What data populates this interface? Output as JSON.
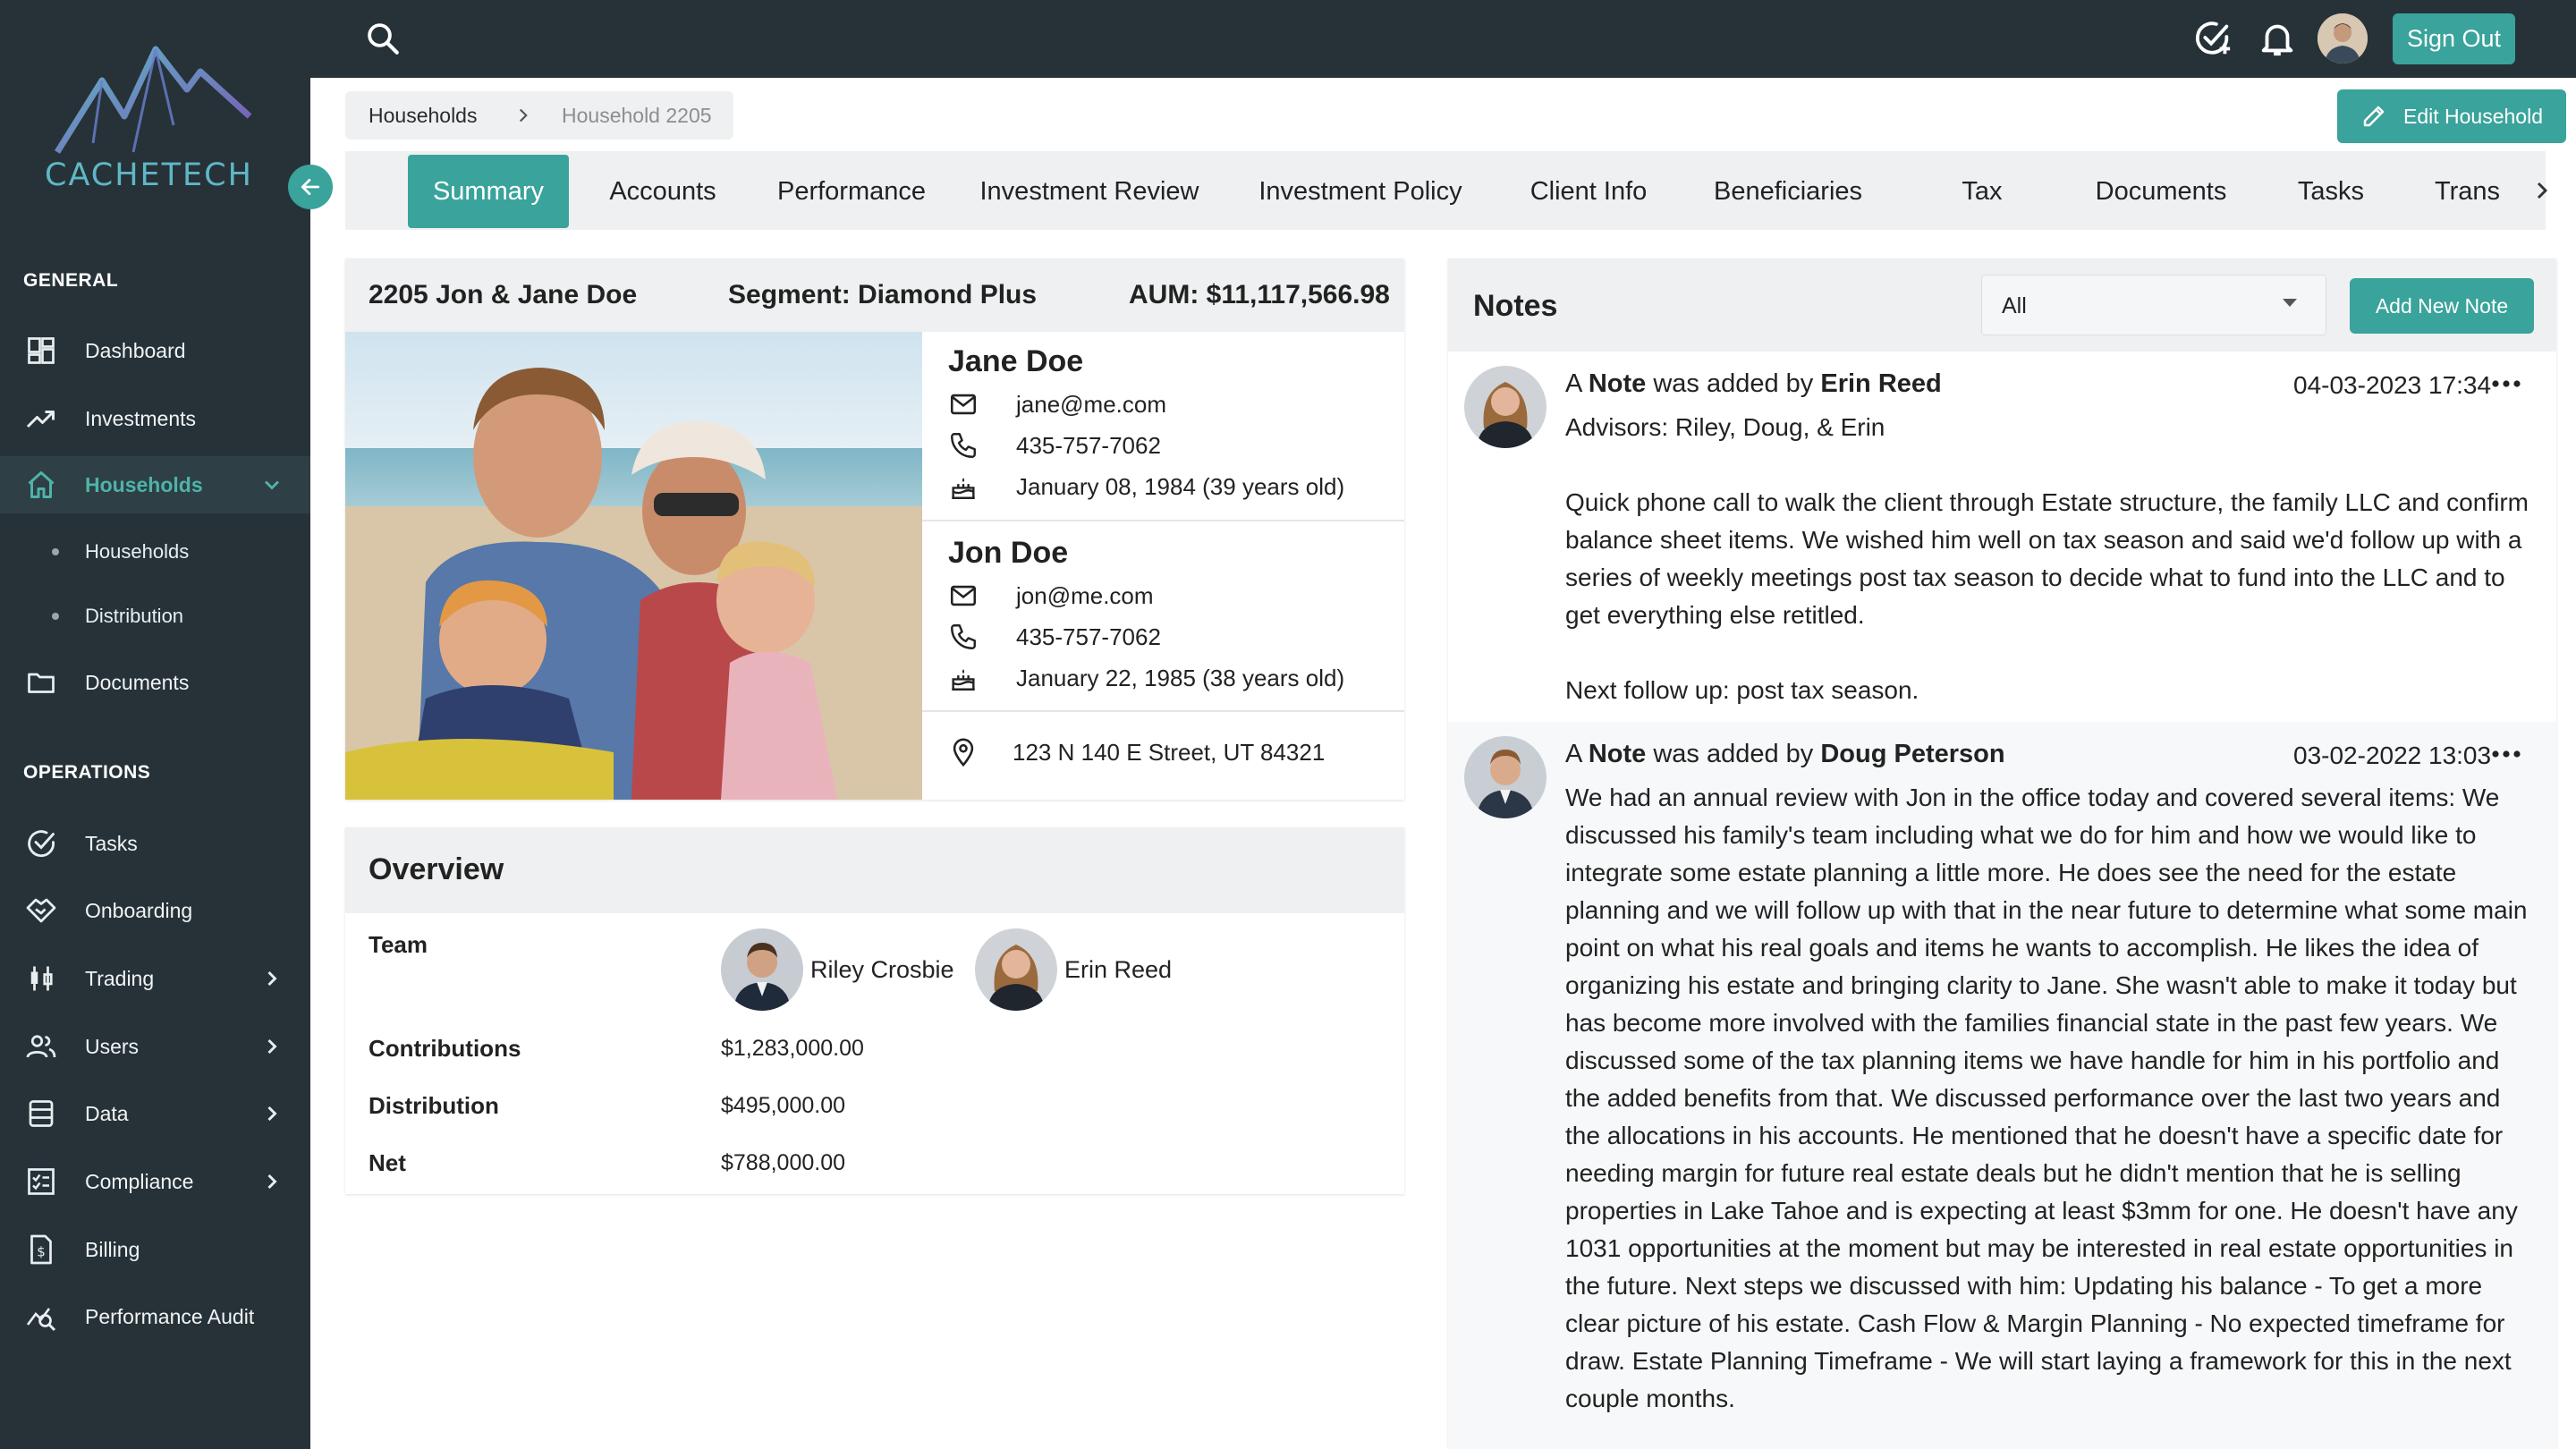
{
  "brand": {
    "name": "CACHETECH",
    "accent": "#3aa39b",
    "sidebar_bg": "#263238"
  },
  "sidebar": {
    "general_title": "GENERAL",
    "operations_title": "OPERATIONS",
    "items": [
      {
        "label": "Dashboard",
        "icon": "dashboard-icon"
      },
      {
        "label": "Investments",
        "icon": "trending-up-icon"
      },
      {
        "label": "Households",
        "icon": "home-icon",
        "active": true
      },
      {
        "label": "Documents",
        "icon": "folder-icon"
      },
      {
        "label": "Tasks",
        "icon": "check-circle-icon"
      },
      {
        "label": "Onboarding",
        "icon": "handshake-icon"
      },
      {
        "label": "Trading",
        "icon": "candlestick-icon"
      },
      {
        "label": "Users",
        "icon": "users-icon"
      },
      {
        "label": "Data",
        "icon": "database-icon"
      },
      {
        "label": "Compliance",
        "icon": "checklist-icon"
      },
      {
        "label": "Billing",
        "icon": "invoice-icon"
      },
      {
        "label": "Performance Audit",
        "icon": "audit-chart-icon"
      }
    ],
    "sub_items": [
      {
        "label": "Households"
      },
      {
        "label": "Distribution"
      }
    ]
  },
  "topbar": {
    "sign_out": "Sign Out"
  },
  "breadcrumb": {
    "root": "Households",
    "current": "Household 2205"
  },
  "edit_household": "Edit Household",
  "tabs": [
    {
      "label": "Summary",
      "active": true
    },
    {
      "label": "Accounts"
    },
    {
      "label": "Performance"
    },
    {
      "label": "Investment Review"
    },
    {
      "label": "Investment Policy"
    },
    {
      "label": "Client Info"
    },
    {
      "label": "Beneficiaries"
    },
    {
      "label": "Tax"
    },
    {
      "label": "Documents"
    },
    {
      "label": "Tasks"
    },
    {
      "label": "Trans"
    }
  ],
  "household": {
    "name": "2205 Jon & Jane Doe",
    "segment": "Segment: Diamond Plus",
    "aum": "AUM: $11,117,566.98",
    "people": [
      {
        "name": "Jane Doe",
        "email": "jane@me.com",
        "phone": "435-757-7062",
        "birthday": "January 08, 1984 (39 years old)"
      },
      {
        "name": "Jon Doe",
        "email": "jon@me.com",
        "phone": "435-757-7062",
        "birthday": "January 22, 1985 (38 years old)"
      }
    ],
    "address": "123 N 140 E Street, UT 84321"
  },
  "overview": {
    "title": "Overview",
    "team_label": "Team",
    "team": [
      {
        "name": "Riley Crosbie"
      },
      {
        "name": "Erin Reed"
      }
    ],
    "contributions_label": "Contributions",
    "contributions": "$1,283,000.00",
    "distribution_label": "Distribution",
    "distribution": "$495,000.00",
    "net_label": "Net",
    "net": "$788,000.00"
  },
  "notes": {
    "title": "Notes",
    "filter_value": "All",
    "add_button": "Add New Note",
    "items": [
      {
        "prefix": "A",
        "kind": "Note",
        "middle": "was added by",
        "author": "Erin Reed",
        "date": "04-03-2023 17:34",
        "paragraphs": [
          "Advisors: Riley, Doug, & Erin",
          "Quick phone call to walk the client through Estate structure, the family LLC and confirm balance sheet items. We wished him well on tax season and said we'd follow up with a series of weekly meetings post tax season to decide what to fund into the LLC and to get everything else retitled.",
          "Next follow up: post tax season."
        ]
      },
      {
        "prefix": "A",
        "kind": "Note",
        "middle": "was added by",
        "author": "Doug Peterson",
        "date": "03-02-2022 13:03",
        "paragraphs": [
          "We had an annual review with Jon in the office today and covered several items: We discussed his family's team including what we do for him and how we would like to integrate some estate planning a little more. He does see the need for the estate planning and we will follow up with that in the near future to determine what some main point on what his real goals and items he wants to accomplish. He likes the idea of organizing his estate and bringing clarity to Jane. She wasn't able to make it today but has become more involved with the families financial state in the past few years. We discussed some of the tax planning items we have handle for him in his portfolio and the added benefits from that. We discussed performance over the last two years and the allocations in his accounts. He mentioned that he doesn't have a specific date for needing margin for future real estate deals but he didn't mention that he is selling properties in Lake Tahoe and is expecting at least $3mm for one. He doesn't have any 1031 opportunities at the moment but may be interested in real estate opportunities in the future. Next steps we discussed with him: Updating his balance - To get a more clear picture of his estate. Cash Flow & Margin Planning - No expected timeframe for draw. Estate Planning Timeframe - We will start laying a framework for this in the next couple months."
        ]
      }
    ]
  }
}
